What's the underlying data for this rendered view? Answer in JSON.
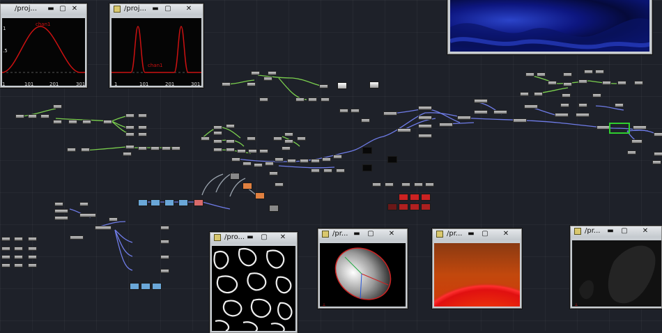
{
  "viewers": {
    "chart1": {
      "title": "/proj...",
      "minimize": "▬",
      "maximize": "▢",
      "close": "✕",
      "channel_label": "chan1",
      "ytick_top": "1",
      "ytick_mid": ".5",
      "xticks": [
        "1",
        "101",
        "201",
        "301"
      ]
    },
    "chart2": {
      "title": "/proj...",
      "minimize": "▬",
      "maximize": "▢",
      "close": "✕",
      "channel_label": "chan1",
      "xticks": [
        "1",
        "101",
        "201",
        "301"
      ]
    },
    "noise": {
      "title": "/pro...",
      "minimize": "▬",
      "maximize": "▢",
      "close": "✕"
    },
    "sphere": {
      "title": "/pr...",
      "minimize": "▬",
      "maximize": "▢",
      "close": "✕"
    },
    "ramp": {
      "title": "/pr...",
      "minimize": "▬",
      "maximize": "▢",
      "close": "✕"
    },
    "dark": {
      "title": "/pr...",
      "minimize": "▬",
      "maximize": "▢",
      "close": "✕"
    }
  },
  "colors": {
    "background": "#1e2129",
    "wire_green": "#7bd04e",
    "wire_blue": "#6f7ce8",
    "wire_grey": "#9aa3ad",
    "chart_line": "#cc1111",
    "selection": "#2fcf2f"
  }
}
